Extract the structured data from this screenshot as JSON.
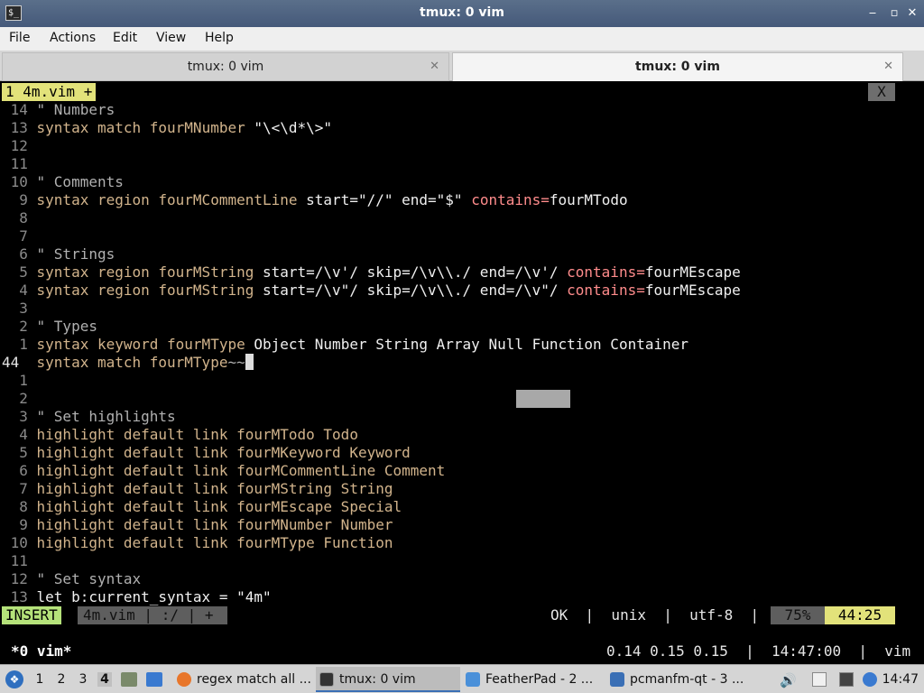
{
  "window": {
    "title": "tmux: 0 vim",
    "terminal_glyph": "$_",
    "minimize": "‒",
    "maximize": "▫",
    "close": "✕"
  },
  "menu": {
    "file": "File",
    "actions": "Actions",
    "edit": "Edit",
    "view": "View",
    "help": "Help"
  },
  "tabs": [
    {
      "label": "tmux: 0 vim",
      "close": "✕"
    },
    {
      "label": "tmux: 0 vim",
      "close": "✕"
    }
  ],
  "vim": {
    "buffer_tab": "1  4m.vim  +",
    "buffer_close": "X",
    "lines": [
      {
        "n": "14",
        "parts": [
          {
            "c": "cm",
            "t": "\" Numbers"
          }
        ]
      },
      {
        "n": "13",
        "parts": [
          {
            "c": "kw",
            "t": "syntax match "
          },
          {
            "c": "kw",
            "t": "fourMNumber "
          },
          {
            "c": "st",
            "t": "\"\\<\\d*\\>\""
          }
        ]
      },
      {
        "n": "12",
        "parts": []
      },
      {
        "n": "11",
        "parts": []
      },
      {
        "n": "10",
        "parts": [
          {
            "c": "cm",
            "t": "\" Comments"
          }
        ]
      },
      {
        "n": "9",
        "parts": [
          {
            "c": "kw",
            "t": "syntax region fourMCommentLine "
          },
          {
            "c": "st",
            "t": "start=\"//\" end=\"$\" "
          },
          {
            "c": "ct",
            "t": "contains="
          },
          {
            "c": "st",
            "t": "fourMTodo"
          }
        ]
      },
      {
        "n": "8",
        "parts": []
      },
      {
        "n": "7",
        "parts": []
      },
      {
        "n": "6",
        "parts": [
          {
            "c": "cm",
            "t": "\" Strings"
          }
        ]
      },
      {
        "n": "5",
        "parts": [
          {
            "c": "kw",
            "t": "syntax region fourMString "
          },
          {
            "c": "st",
            "t": "start=/\\v'/ skip=/\\v\\\\./ end=/\\v'/ "
          },
          {
            "c": "ct",
            "t": "contains="
          },
          {
            "c": "st",
            "t": "fourMEscape"
          }
        ]
      },
      {
        "n": "4",
        "parts": [
          {
            "c": "kw",
            "t": "syntax region fourMString "
          },
          {
            "c": "st",
            "t": "start=/\\v\"/ skip=/\\v\\\\./ end=/\\v\"/ "
          },
          {
            "c": "ct",
            "t": "contains="
          },
          {
            "c": "st",
            "t": "fourMEscape"
          }
        ]
      },
      {
        "n": "3",
        "parts": []
      },
      {
        "n": "2",
        "parts": [
          {
            "c": "cm",
            "t": "\" Types"
          }
        ]
      },
      {
        "n": "1",
        "parts": [
          {
            "c": "kw",
            "t": "syntax keyword fourMType "
          },
          {
            "c": "st",
            "t": "Object Number String Array Null Function Container"
          }
        ]
      },
      {
        "n": "44",
        "parts": [
          {
            "c": "kw",
            "t": "syntax match fourMType"
          },
          {
            "c": "cm",
            "t": "~~"
          }
        ],
        "cursor": true
      },
      {
        "n": "1",
        "parts": []
      },
      {
        "n": "2",
        "parts": []
      },
      {
        "n": "3",
        "parts": [
          {
            "c": "cm",
            "t": "\" Set highlights"
          }
        ]
      },
      {
        "n": "4",
        "parts": [
          {
            "c": "kw",
            "t": "highlight default link fourMTodo Todo"
          }
        ]
      },
      {
        "n": "5",
        "parts": [
          {
            "c": "kw",
            "t": "highlight default link fourMKeyword Keyword"
          }
        ]
      },
      {
        "n": "6",
        "parts": [
          {
            "c": "kw",
            "t": "highlight default link fourMCommentLine Comment"
          }
        ]
      },
      {
        "n": "7",
        "parts": [
          {
            "c": "kw",
            "t": "highlight default link fourMString String"
          }
        ]
      },
      {
        "n": "8",
        "parts": [
          {
            "c": "kw",
            "t": "highlight default link fourMEscape Special"
          }
        ]
      },
      {
        "n": "9",
        "parts": [
          {
            "c": "kw",
            "t": "highlight default link fourMNumber Number"
          }
        ]
      },
      {
        "n": "10",
        "parts": [
          {
            "c": "kw",
            "t": "highlight default link fourMType Function"
          }
        ]
      },
      {
        "n": "11",
        "parts": []
      },
      {
        "n": "12",
        "parts": [
          {
            "c": "cm",
            "t": "\" Set syntax"
          }
        ]
      },
      {
        "n": "13",
        "parts": [
          {
            "c": "st",
            "t": "let b:current_syntax = \"4m\""
          }
        ]
      }
    ],
    "status": {
      "mode": "INSERT",
      "file": "4m.vim  |  :/  |  +",
      "info": "OK  |  unix  |  utf-8  |  vim",
      "percent": "75%",
      "position": "44:25"
    }
  },
  "tmux": {
    "window": "*0 vim*",
    "right": "0.14 0.15 0.15  |  14:47:00  |  vim"
  },
  "taskbar": {
    "workspaces": [
      "1",
      "2",
      "3",
      "4"
    ],
    "tasks": [
      {
        "label": "regex match all ...",
        "icon": "firefox-icon"
      },
      {
        "label": "tmux: 0 vim",
        "icon": "terminal-icon"
      },
      {
        "label": "FeatherPad - 2 ...",
        "icon": "featherpad-icon"
      },
      {
        "label": "pcmanfm-qt - 3 ...",
        "icon": "folder-icon"
      }
    ],
    "clock": "14:47"
  },
  "colors": {
    "accent": "#3a6fb5",
    "vim_tab": "#e2e27a",
    "insert_mode": "#b5e27a"
  }
}
